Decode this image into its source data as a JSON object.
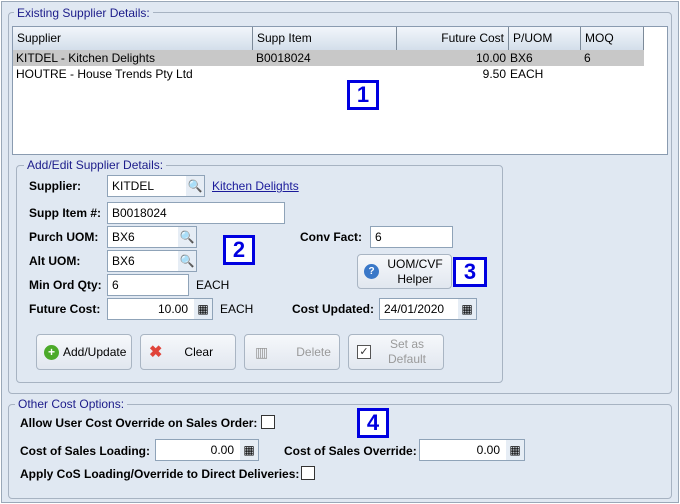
{
  "existing": {
    "legend": "Existing Supplier Details:",
    "columns": [
      "Supplier",
      "Supp Item",
      "Future Cost",
      "P/UOM",
      "MOQ"
    ],
    "rows": [
      [
        "KITDEL - Kitchen Delights",
        "B0018024",
        "10.00",
        "BX6",
        "6"
      ],
      [
        "HOUTRE - House Trends Pty Ltd",
        "",
        "9.50",
        "EACH",
        ""
      ]
    ],
    "selected_row_color": "#c8c8c8"
  },
  "edit": {
    "legend": "Add/Edit Supplier Details:",
    "supplier_label": "Supplier:",
    "supplier_value": "KITDEL",
    "supplier_link": "Kitchen Delights",
    "supp_item_label": "Supp Item #:",
    "supp_item_value": "B0018024",
    "purch_uom_label": "Purch UOM:",
    "purch_uom_value": "BX6",
    "alt_uom_label": "Alt UOM:",
    "alt_uom_value": "BX6",
    "min_ord_label": "Min Ord Qty:",
    "min_ord_value": "6",
    "min_ord_unit": "EACH",
    "future_cost_label": "Future Cost:",
    "future_cost_value": "10.00",
    "future_cost_unit": "EACH",
    "conv_fact_label": "Conv Fact:",
    "conv_fact_value": "6",
    "helper_line1": "UOM/CVF",
    "helper_line2": "Helper",
    "cost_updated_label": "Cost Updated:",
    "cost_updated_value": "24/01/2020",
    "add_update": "Add/Update",
    "clear": "Clear",
    "delete": "Delete",
    "set_default_1": "Set as",
    "set_default_2": "Default"
  },
  "other": {
    "legend": "Other Cost Options:",
    "allow_override_label": "Allow User Cost Override on Sales Order:",
    "loading_label": "Cost of Sales Loading:",
    "loading_value": "0.00",
    "override_label": "Cost of Sales Override:",
    "override_value": "0.00",
    "apply_label": "Apply CoS Loading/Override to Direct Deliveries:"
  },
  "badges": [
    "1",
    "2",
    "3",
    "4"
  ],
  "accent": "#0000e0"
}
